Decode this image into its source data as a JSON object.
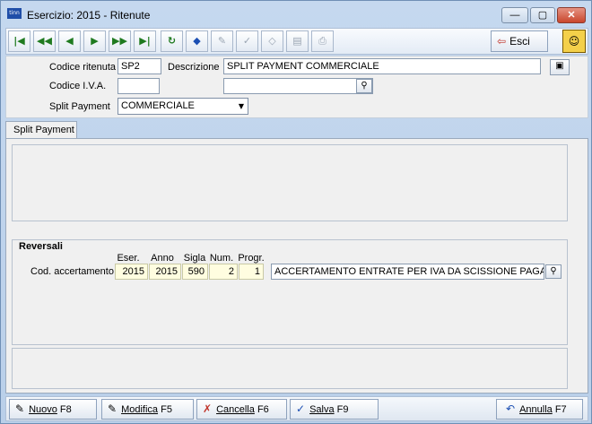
{
  "window": {
    "title": "Esercizio: 2015 - Ritenute",
    "app_icon_text": "tinn",
    "minimize_glyph": "—",
    "maximize_glyph": "▢",
    "close_glyph": "✕"
  },
  "toolbar": {
    "esci_label": "Esci",
    "buttons": [
      "first-icon",
      "prev-page-icon",
      "prev-icon",
      "next-icon",
      "next-page-icon",
      "last-icon",
      "refresh-icon",
      "new-record-icon",
      "edit-disabled-icon",
      "check-disabled-icon",
      "erase-disabled-icon",
      "preview-icon",
      "print-icon"
    ]
  },
  "header": {
    "codice_ritenuta_label": "Codice ritenuta",
    "codice_ritenuta_value": "SP2",
    "descrizione_label": "Descrizione",
    "descrizione_value": "SPLIT PAYMENT COMMERCIALE",
    "codice_iva_label": "Codice I.V.A.",
    "codice_iva_value": "",
    "iva_desc_value": "",
    "split_payment_label": "Split Payment",
    "split_payment_value": "COMMERCIALE"
  },
  "tabs": [
    {
      "label": "Split Payment"
    }
  ],
  "reversali": {
    "title": "Reversali",
    "columns": [
      "Eser.",
      "Anno",
      "Sigla",
      "Num.",
      "Progr."
    ],
    "row_label": "Cod. accertamento",
    "eser": "2015",
    "anno": "2015",
    "sigla": "590",
    "num": "2",
    "progr": "1",
    "descrizione": "ACCERTAMENTO ENTRATE PER IVA DA SCISSIONE PAGAI"
  },
  "actions": {
    "nuovo": "Nuovo",
    "nuovo_key": "F8",
    "modifica": "Modifica",
    "modifica_key": "F5",
    "cancella": "Cancella",
    "cancella_key": "F6",
    "salva": "Salva",
    "salva_key": "F9",
    "annulla": "Annulla",
    "annulla_key": "F7"
  }
}
